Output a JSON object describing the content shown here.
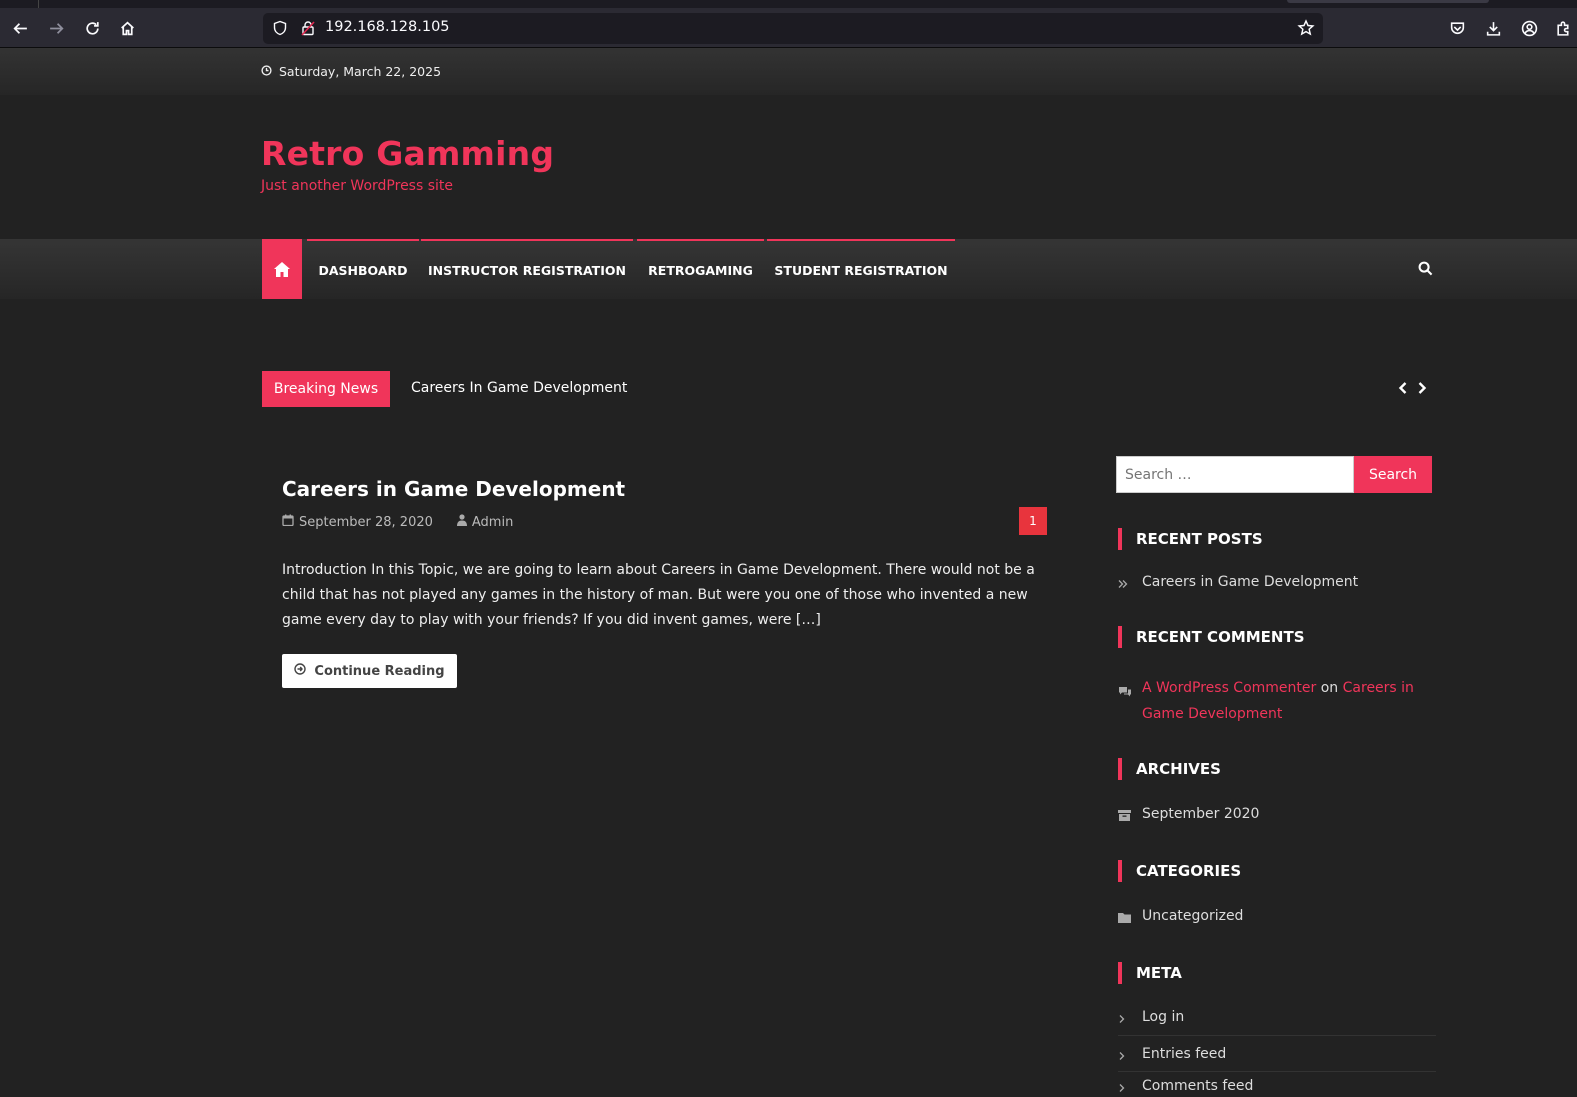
{
  "browser": {
    "url": "192.168.128.105"
  },
  "topbar": {
    "date": "Saturday, March 22, 2025"
  },
  "site": {
    "title": "Retro Gamming",
    "description": "Just another WordPress site"
  },
  "nav": {
    "items": [
      {
        "label": "DASHBOARD"
      },
      {
        "label": "INSTRUCTOR REGISTRATION"
      },
      {
        "label": "RETROGAMING"
      },
      {
        "label": "STUDENT REGISTRATION"
      }
    ]
  },
  "breaking_news": {
    "label": "Breaking News",
    "headline": "Careers In Game Development"
  },
  "post": {
    "title": "Careers in Game Development",
    "date": "September 28, 2020",
    "author": "Admin",
    "comment_count": "1",
    "excerpt": "Introduction In this Topic, we are going to learn about Careers in Game Development. There would not be a child that has not played any games in the history of man. But were you one of those who invented a new game every day to play with your friends? If you did invent games, were […]",
    "continue_label": "Continue Reading"
  },
  "sidebar": {
    "search_placeholder": "Search …",
    "search_button": "Search",
    "recent_posts": {
      "title": "RECENT POSTS",
      "items": [
        "Careers in Game Development"
      ]
    },
    "recent_comments": {
      "title": "RECENT COMMENTS",
      "author": "A WordPress Commenter",
      "on": "on",
      "post_line1": "Careers in",
      "post_line2": "Game Development"
    },
    "archives": {
      "title": "ARCHIVES",
      "items": [
        "September 2020"
      ]
    },
    "categories": {
      "title": "CATEGORIES",
      "items": [
        "Uncategorized"
      ]
    },
    "meta": {
      "title": "META",
      "items": [
        "Log in",
        "Entries feed",
        "Comments feed"
      ]
    }
  },
  "colors": {
    "accent": "#f0355a",
    "background": "#222222"
  }
}
